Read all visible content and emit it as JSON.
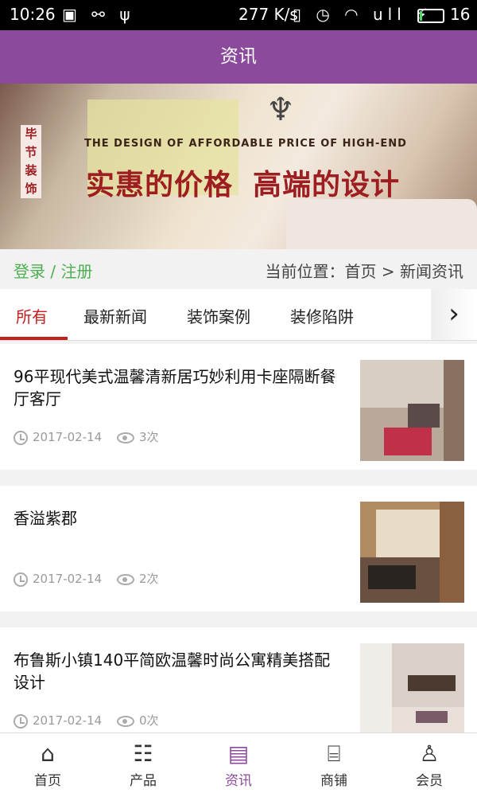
{
  "status_bar": {
    "time": "10:26",
    "left_icons": "▣ ⚯ ψ",
    "speed": "277 K/s",
    "right_icons": "▯ ◷ ◠ ull ⚡",
    "battery_level": "16"
  },
  "app_bar": {
    "title": "资讯"
  },
  "banner": {
    "tag": "毕节装饰",
    "english": "THE DESIGN OF AFFORDABLE PRICE OF HIGH-END",
    "slogan_1": "实惠的价格",
    "slogan_2": "高端的设计"
  },
  "crumb_bar": {
    "login": "登录 / 注册",
    "location": "当前位置：首页 > 新闻资讯"
  },
  "tabs": [
    "所有",
    "最新新闻",
    "装饰案例",
    "装修陷阱"
  ],
  "articles": [
    {
      "title": "96平现代美式温馨清新居巧妙利用卡座隔断餐厅客厅",
      "date": "2017-02-14",
      "views": "3次"
    },
    {
      "title": "香溢紫郡",
      "date": "2017-02-14",
      "views": "2次"
    },
    {
      "title": "布鲁斯小镇140平简欧温馨时尚公寓精美搭配设计",
      "date": "2017-02-14",
      "views": "0次"
    }
  ],
  "nav": {
    "items": [
      {
        "label": "首页",
        "icon": "home-icon"
      },
      {
        "label": "产品",
        "icon": "list-icon"
      },
      {
        "label": "资讯",
        "icon": "news-icon"
      },
      {
        "label": "商铺",
        "icon": "shop-icon"
      },
      {
        "label": "会员",
        "icon": "user-icon"
      }
    ],
    "active_color": "#8b4a9c"
  },
  "colors": {
    "app_bar": "#8b4a9c",
    "active_tab": "#c41e1e",
    "login": "#4caf50"
  }
}
